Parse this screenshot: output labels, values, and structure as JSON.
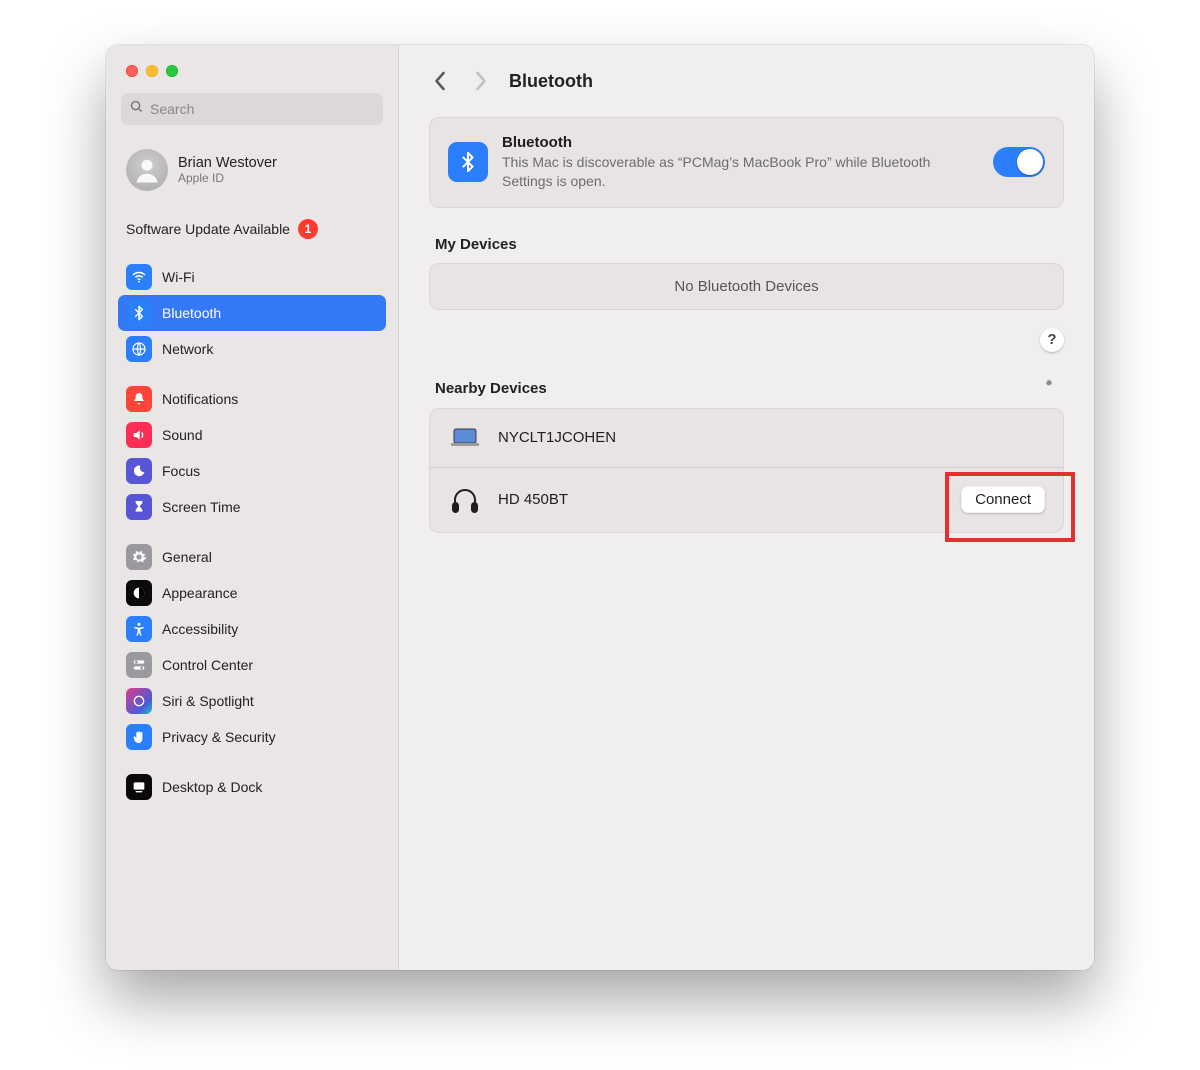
{
  "sidebar": {
    "search_placeholder": "Search",
    "account": {
      "name": "Brian Westover",
      "sub": "Apple ID"
    },
    "update": {
      "label": "Software Update Available",
      "badge": "1"
    },
    "groups": [
      {
        "items": [
          {
            "label": "Wi-Fi"
          },
          {
            "label": "Bluetooth"
          },
          {
            "label": "Network"
          }
        ]
      },
      {
        "items": [
          {
            "label": "Notifications"
          },
          {
            "label": "Sound"
          },
          {
            "label": "Focus"
          },
          {
            "label": "Screen Time"
          }
        ]
      },
      {
        "items": [
          {
            "label": "General"
          },
          {
            "label": "Appearance"
          },
          {
            "label": "Accessibility"
          },
          {
            "label": "Control Center"
          },
          {
            "label": "Siri & Spotlight"
          },
          {
            "label": "Privacy & Security"
          }
        ]
      },
      {
        "items": [
          {
            "label": "Desktop & Dock"
          }
        ]
      }
    ]
  },
  "main": {
    "title": "Bluetooth",
    "status_card": {
      "title": "Bluetooth",
      "desc": "This Mac is discoverable as “PCMag’s MacBook Pro” while Bluetooth Settings is open.",
      "toggle_on": true
    },
    "my_devices": {
      "title": "My Devices",
      "empty": "No Bluetooth Devices"
    },
    "help_label": "?",
    "nearby": {
      "title": "Nearby Devices",
      "devices": [
        {
          "name": "NYCLT1JCOHEN",
          "kind": "laptop"
        },
        {
          "name": "HD 450BT",
          "kind": "headphones",
          "action": "Connect"
        }
      ]
    }
  }
}
